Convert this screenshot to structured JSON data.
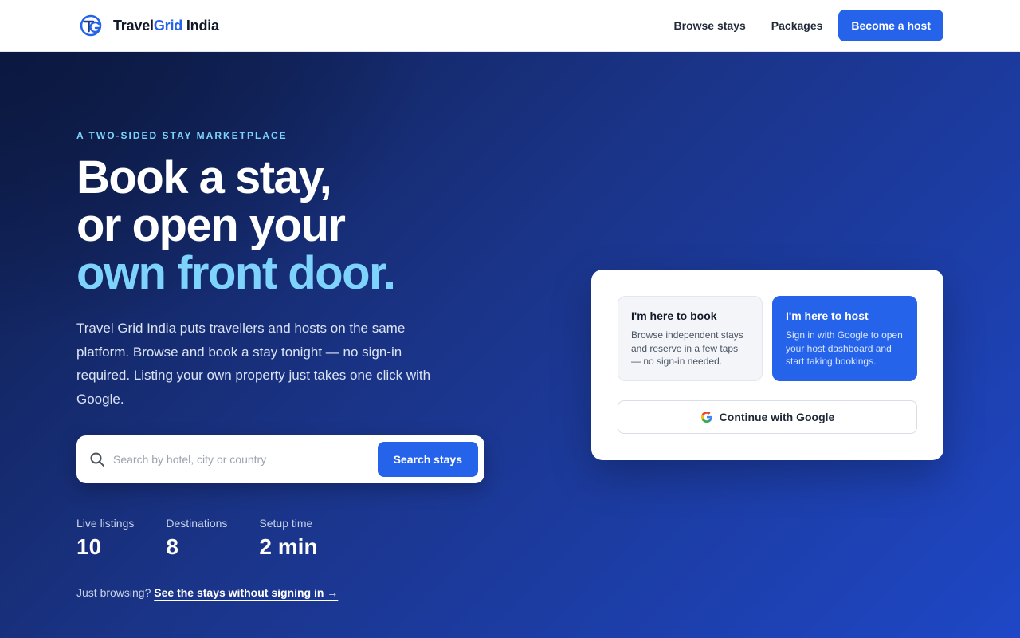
{
  "header": {
    "brand": {
      "name_part1": "Travel",
      "name_part2": "Grid",
      "name_part3": " India",
      "logo_icon": "tg-logo-icon"
    },
    "nav": {
      "browse_stays": "Browse stays",
      "packages": "Packages",
      "become_host": "Become a host"
    }
  },
  "hero": {
    "eyebrow": "A TWO-SIDED STAY MARKETPLACE",
    "headline": {
      "line1": "Book a stay,",
      "line2": "or open your",
      "line3": "own front door."
    },
    "lead": "Travel Grid India puts travellers and hosts on the same platform. Browse and book a stay tonight — no sign-in required. Listing your own property just takes one click with Google.",
    "search": {
      "placeholder": "Search by hotel, city or country",
      "value": "",
      "button": "Search stays",
      "icon": "search-icon"
    },
    "stats": [
      {
        "label": "Live listings",
        "value": "10"
      },
      {
        "label": "Destinations",
        "value": "8"
      },
      {
        "label": "Setup time",
        "value": "2 min"
      }
    ],
    "browse": {
      "prefix": "Just browsing?",
      "link": "See the stays without signing in →"
    }
  },
  "role_card": {
    "book": {
      "title": "I'm here to book",
      "desc": "Browse independent stays and reserve in a few taps — no sign-in needed."
    },
    "host": {
      "title": "I'm here to host",
      "desc": "Sign in with Google to open your host dashboard and start taking bookings."
    },
    "google_button": {
      "label": "Continue with Google",
      "icon": "google-icon"
    }
  },
  "colors": {
    "accent": "#2563eb",
    "highlight": "#7dd3fc",
    "hero_dark": "#0f1e4c",
    "hero_light": "#1f47c6"
  }
}
